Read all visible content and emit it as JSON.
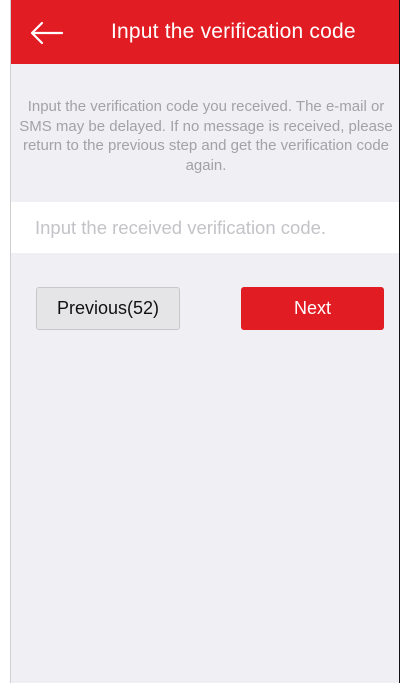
{
  "header": {
    "back_icon": "arrow-left-icon",
    "title": "Input the verification code"
  },
  "hint_text": "Input the verification code you received. The e-mail or SMS may be delayed. If no message is received, please return to the previous step and get the verification code again.",
  "code_input": {
    "value": "",
    "placeholder": "Input the received verification code."
  },
  "buttons": {
    "previous_label": "Previous(52)",
    "next_label": "Next"
  },
  "colors": {
    "brand_red": "#e21c23",
    "background": "#efeff4",
    "hint_text": "#a2a2a7",
    "secondary_button": "#e5e5e8"
  }
}
